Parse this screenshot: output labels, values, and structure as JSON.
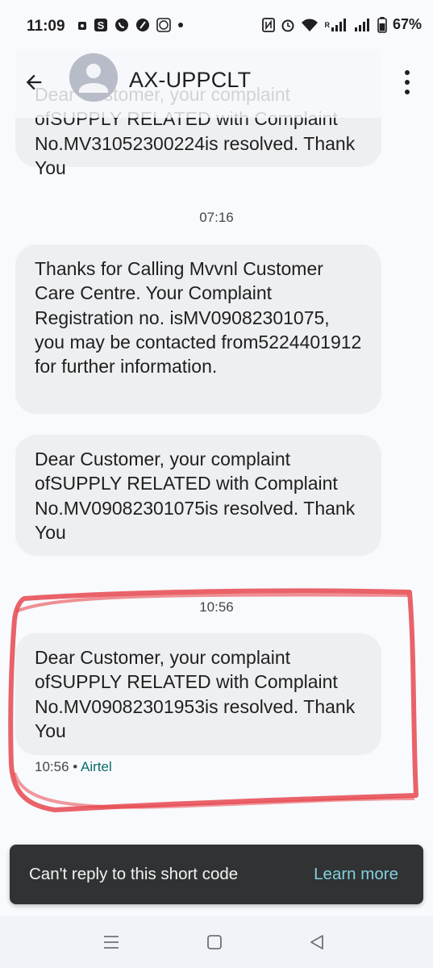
{
  "status_bar": {
    "time": "11:09",
    "battery": "67%",
    "signal_label": "R",
    "icons_left": [
      "photo-notification-icon",
      "swiggy-icon",
      "whatsapp-icon",
      "app-icon",
      "cb-icon",
      "more-notifications-dot-icon"
    ],
    "icons_right": [
      "nfc-icon",
      "alarm-icon",
      "wifi-icon",
      "signal-icon",
      "signal-icon",
      "battery-icon"
    ]
  },
  "header": {
    "title": "AX-UPPCLT",
    "back_icon": "arrow-back-icon",
    "avatar_icon": "person-avatar-icon",
    "menu_icon": "more-vert-icon"
  },
  "messages": [
    {
      "text": "Dear Customer, your complaint ofSUPPLY RELATED with Complaint No.MV31052300224is resolved. Thank You"
    },
    {
      "timestamp": "07:16"
    },
    {
      "text": "Thanks for Calling Mvvnl Customer Care Centre. Your Complaint Registration no. isMV09082301075, you may be contacted from5224401912 for further information."
    },
    {
      "text": "Dear Customer, your complaint ofSUPPLY RELATED with Complaint No.MV09082301075is resolved. Thank You"
    },
    {
      "timestamp": "10:56"
    },
    {
      "text": "Dear Customer, your complaint ofSUPPLY RELATED with Complaint No.MV09082301953is resolved. Thank You",
      "meta_time": "10:56",
      "meta_sep": " • ",
      "meta_carrier": "Airtel"
    }
  ],
  "snackbar": {
    "message": "Can't reply to this short code",
    "action": "Learn more"
  },
  "nav": {
    "icons": [
      "recents-icon",
      "home-icon",
      "back-icon"
    ]
  },
  "colors": {
    "background": "#f8fafd",
    "bubble": "#eeeff1",
    "snackbar": "#303233",
    "snackbar_action": "#82cfe0",
    "highlight": "#e8474f",
    "carrier": "#0b6b6b"
  }
}
